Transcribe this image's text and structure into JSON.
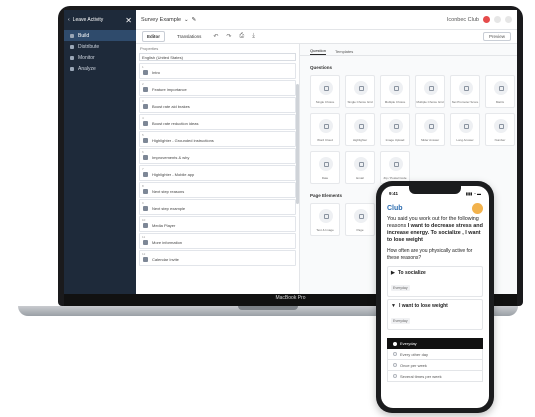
{
  "app": {
    "back_label": "Leave Activity",
    "close_glyph": "✕",
    "survey_title": "Survey Example",
    "account_name": "Iconbec Club",
    "preview_label": "Preview"
  },
  "sidebar": {
    "items": [
      {
        "label": "Build",
        "active": true
      },
      {
        "label": "Distribute",
        "active": false
      },
      {
        "label": "Monitor",
        "active": false
      },
      {
        "label": "Analyze",
        "active": false
      }
    ]
  },
  "toolbar": {
    "tabs": [
      "Editor",
      "Translations"
    ],
    "undo_glyph": "↶",
    "redo_glyph": "↷",
    "print_glyph": "⎙",
    "download_glyph": "⤓"
  },
  "outline": {
    "title": "Properties",
    "language": "English (United States)",
    "items": [
      {
        "num": "1",
        "label": "Intro"
      },
      {
        "num": "2",
        "label": "Feature importance"
      },
      {
        "num": "3",
        "label": "Boost rate aid brakes"
      },
      {
        "num": "4",
        "label": "Boost rate reduction ideas"
      },
      {
        "num": "5",
        "label": "Highlighter - Grounded instructions"
      },
      {
        "num": "6",
        "label": "Improvements & why"
      },
      {
        "num": "7",
        "label": "Highlighter - Mobile app"
      },
      {
        "num": "8",
        "label": "Next step reasons"
      },
      {
        "num": "9",
        "label": "Next step example"
      },
      {
        "num": "10",
        "label": "Media Player"
      },
      {
        "num": "11",
        "label": "More information"
      },
      {
        "num": "12",
        "label": "Calendar Invite"
      }
    ]
  },
  "types": {
    "tabs": [
      "Question",
      "Templates"
    ],
    "questions_heading": "Questions",
    "question_types": [
      "Single Choice",
      "Single Choice Grid",
      "Multiple Choice",
      "Multiple Choice Grid",
      "Net Promoter Score",
      "Matrix",
      "Word Cloud",
      "Highlighter",
      "Image Upload",
      "Slider Answer",
      "Long Answer",
      "Number",
      "Date",
      "Email",
      "Zip / Postal Code"
    ],
    "page_elements_heading": "Page Elements",
    "page_elements": [
      "Text & Image",
      "Page",
      "Media Player"
    ]
  },
  "laptop": {
    "model_label": "MacBook Pro"
  },
  "phone": {
    "time": "9:41",
    "signal": "▮▮▮ ◔ ▬",
    "brand_prefix": "",
    "brand_name": "Club",
    "intro_plain": "You said you work out for the following reasons",
    "intro_bold": "I want to decrease stress and increase energy. To socialize , I want to lose weight",
    "question": "How often are you physically active for these reasons?",
    "reasons": [
      {
        "label": "To socialize",
        "tag": "Everyday",
        "arrow": "▶"
      },
      {
        "label": "I want to lose weight",
        "tag": "Everyday",
        "arrow": "▼"
      }
    ],
    "options": [
      {
        "label": "Everyday",
        "selected": true
      },
      {
        "label": "Every other day",
        "selected": false
      },
      {
        "label": "Once per week",
        "selected": false
      },
      {
        "label": "Several times per week",
        "selected": false
      }
    ]
  }
}
